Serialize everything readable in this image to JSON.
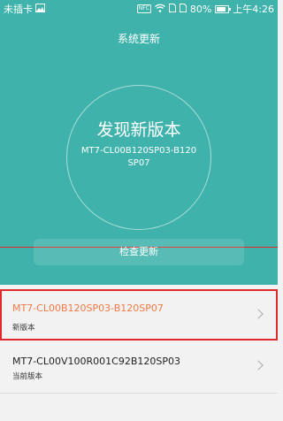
{
  "status_bar": {
    "carrier": "未插卡",
    "nfc": "NFC",
    "battery_percent": "80%",
    "battery_level": 0.8,
    "time": "上午4:26"
  },
  "header": {
    "title": "系统更新"
  },
  "hero": {
    "headline": "发现新版本",
    "version": "MT7-CL00B120SP03-B120SP07"
  },
  "actions": {
    "check_update": "检查更新"
  },
  "list": [
    {
      "title": "MT7-CL00B120SP03-B120SP07",
      "subtitle": "新版本",
      "title_color": "#f07a45"
    },
    {
      "title": "MT7-CL00V100R001C92B120SP03",
      "subtitle": "当前版本",
      "title_color": "#222222"
    }
  ],
  "colors": {
    "hero_bg": "#3fb3ab",
    "highlight": "#e0292b"
  }
}
